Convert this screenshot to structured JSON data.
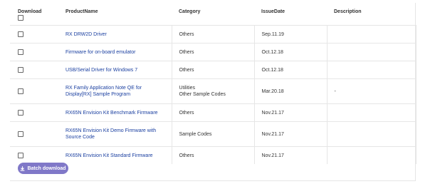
{
  "table": {
    "headers": {
      "download": "Download",
      "product_name": "ProductName",
      "category": "Category",
      "issue_date": "IssueDate",
      "description": "Description"
    },
    "rows": [
      {
        "product": "RX DRW2D Driver",
        "category_lines": [
          "Others"
        ],
        "date": "Sep.11.19",
        "description": ""
      },
      {
        "product": "Firmware for on-board emulator",
        "category_lines": [
          "Others"
        ],
        "date": "Oct.12.18",
        "description": ""
      },
      {
        "product": "USB/Serial Driver for Windows 7",
        "category_lines": [
          "Others"
        ],
        "date": "Oct.12.18",
        "description": ""
      },
      {
        "product": "RX Family Application Note QE for Display[RX] Sample Program",
        "category_lines": [
          "Utilities",
          "Other Sample Codes"
        ],
        "date": "Mar.20.18",
        "description": "-"
      },
      {
        "product": "RX65N Envision Kit Benchmark Firmware",
        "category_lines": [
          "Others"
        ],
        "date": "Nov.21.17",
        "description": ""
      },
      {
        "product": "RX65N Envision Kit Demo Firmware with Source Code",
        "category_lines": [
          "Sample Codes"
        ],
        "date": "Nov.21.17",
        "description": ""
      },
      {
        "product": "RX65N Envision Kit Standard Firmware",
        "category_lines": [
          "Others"
        ],
        "date": "Nov.21.17",
        "description": ""
      }
    ]
  },
  "batch_download": {
    "label": "Batch download",
    "icon": "download-icon",
    "color": "#8078c8"
  },
  "colors": {
    "link": "#1a3fa0",
    "border": "#e6e6e6",
    "text": "#333333"
  }
}
